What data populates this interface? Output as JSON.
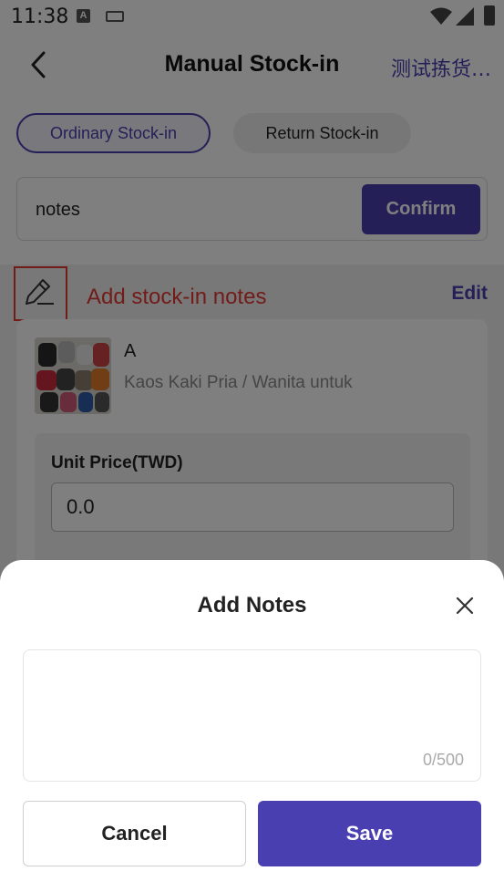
{
  "status_bar": {
    "time": "11:38",
    "notification_letter": "A"
  },
  "nav": {
    "title": "Manual Stock-in",
    "right_text": "测试拣货…"
  },
  "tabs": [
    {
      "label": "Ordinary Stock-in",
      "active": true
    },
    {
      "label": "Return Stock-in",
      "active": false
    }
  ],
  "notes_input": {
    "value": "notes",
    "confirm_label": "Confirm"
  },
  "notes_section": {
    "annotation": "Add stock-in notes",
    "edit_label": "Edit"
  },
  "product": {
    "name": "A",
    "description": "Kaos Kaki Pria / Wanita untuk",
    "unit_price_label": "Unit Price(TWD)",
    "unit_price_value": "0.0"
  },
  "sheet": {
    "title": "Add Notes",
    "textarea_value": "",
    "counter": "0/500",
    "cancel_label": "Cancel",
    "save_label": "Save"
  },
  "colors": {
    "accent": "#4a3fb0",
    "annotation_red": "#e53935",
    "overlay": "rgba(0,0,0,0.5)"
  },
  "icons": {
    "back": "chevron-left-icon",
    "edit": "pencil-icon",
    "close": "close-icon",
    "wifi": "wifi-icon",
    "signal": "signal-icon",
    "battery": "battery-icon"
  }
}
